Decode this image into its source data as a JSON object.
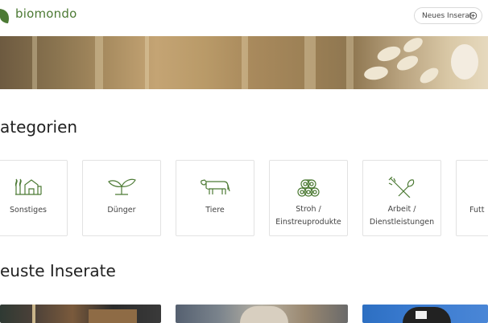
{
  "brand": {
    "name": "biomondo",
    "color": "#4c7a34"
  },
  "header": {
    "cta_label": "Neues Inserat",
    "cta_icon": "plus-circle-icon"
  },
  "sections": {
    "categories_title": "ategorien",
    "latest_title": "euste Inserate"
  },
  "categories": [
    {
      "label": "Sonstiges",
      "icon": "farm-icon"
    },
    {
      "label": "Dünger",
      "icon": "sprout-icon"
    },
    {
      "label": "Tiere",
      "icon": "cow-icon"
    },
    {
      "label_line1": "Stroh /",
      "label_line2": "Einstreuprodukte",
      "icon": "hay-bales-icon"
    },
    {
      "label_line1": "Arbeit /",
      "label_line2": "Dienstleistungen",
      "icon": "tools-icon"
    },
    {
      "label": "Futt",
      "icon": "feed-icon"
    }
  ],
  "colors": {
    "icon_green": "#4c7a34",
    "border": "#e2e2e2"
  }
}
